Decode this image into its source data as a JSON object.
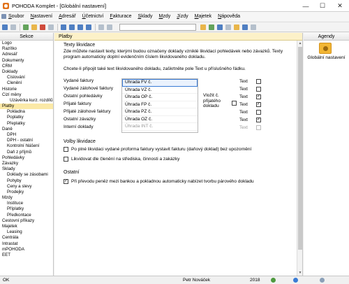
{
  "window": {
    "title": "POHODA Komplet - [Globální nastavení]"
  },
  "menu": [
    "Soubor",
    "Nastavení",
    "Adresář",
    "Účetnictví",
    "Fakturace",
    "Sklady",
    "Mzdy",
    "Jízdy",
    "Majetek",
    "Nápověda"
  ],
  "sidebar": {
    "title": "Sekce",
    "items": [
      {
        "label": "Logo",
        "level": 0
      },
      {
        "label": "Razítko",
        "level": 0
      },
      {
        "label": "Adresář",
        "level": 0
      },
      {
        "label": "Dokumenty",
        "level": 0
      },
      {
        "label": "CRM",
        "level": 0
      },
      {
        "label": "Doklady",
        "level": 0
      },
      {
        "label": "Číslování",
        "level": 1
      },
      {
        "label": "Členění",
        "level": 1
      },
      {
        "label": "Historie",
        "level": 0
      },
      {
        "label": "Cizí měny",
        "level": 0
      },
      {
        "label": "Uzávěrka kurz. rozdílů",
        "level": 2
      },
      {
        "label": "Platby",
        "level": 0,
        "active": true
      },
      {
        "label": "Pokladna",
        "level": 1
      },
      {
        "label": "Poplatky",
        "level": 1
      },
      {
        "label": "Přeplatky",
        "level": 1
      },
      {
        "label": "Daně",
        "level": 0
      },
      {
        "label": "DPH",
        "level": 1
      },
      {
        "label": "DPH - ostatní",
        "level": 1
      },
      {
        "label": "Kontrolní hlášení",
        "level": 1
      },
      {
        "label": "Daň z příjmů",
        "level": 1
      },
      {
        "label": "Pohledávky",
        "level": 0
      },
      {
        "label": "Závazky",
        "level": 0
      },
      {
        "label": "Sklady",
        "level": 0
      },
      {
        "label": "Doklady se zásobami",
        "level": 1
      },
      {
        "label": "Pohyby",
        "level": 1
      },
      {
        "label": "Ceny a slevy",
        "level": 1
      },
      {
        "label": "Prodejky",
        "level": 1
      },
      {
        "label": "Mzdy",
        "level": 0
      },
      {
        "label": "Instituce",
        "level": 1
      },
      {
        "label": "Příplatky",
        "level": 1
      },
      {
        "label": "Předkontace",
        "level": 1
      },
      {
        "label": "Cestovní příkazy",
        "level": 0
      },
      {
        "label": "Majetek",
        "level": 0
      },
      {
        "label": "Leasing",
        "level": 1
      },
      {
        "label": "Centrála",
        "level": 0
      },
      {
        "label": "Intrastat",
        "level": 0
      },
      {
        "label": "mPOHODA",
        "level": 0
      },
      {
        "label": "EET",
        "level": 0
      }
    ]
  },
  "main": {
    "header": "Platby",
    "texty": {
      "title": "Texty likvidace",
      "para1": "Zde můžete nastavit texty, kterými budou označeny doklady vzniklé likvidací pohledávek nebo závazků. Texty program automaticky doplní evidenčním číslem likvidovaného dokladu.",
      "para2": "Chcete-li připojit také text likvidovaného dokladu, zaškrtněte pole Text u příslušného řádku."
    },
    "rows": [
      {
        "label": "Vydané faktury",
        "prefix": "Úhrada FV č.",
        "text": "Text",
        "checked": false,
        "selected": true,
        "disabled": false
      },
      {
        "label": "Vydané zálohové faktury",
        "prefix": "Úhrada VZ č.",
        "text": "Text",
        "checked": false,
        "selected": false,
        "disabled": false
      },
      {
        "label": "Ostatní pohledávky",
        "prefix": "Úhrada OP č.",
        "text": "Text",
        "checked": true,
        "selected": false,
        "disabled": false
      },
      {
        "label": "Přijaté faktury",
        "prefix": "Úhrada FP č.",
        "text": "Text",
        "checked": true,
        "selected": false,
        "disabled": false
      },
      {
        "label": "Přijaté zálohové faktury",
        "prefix": "Úhrada PZ č.",
        "text": "Text",
        "checked": false,
        "selected": false,
        "disabled": false
      },
      {
        "label": "Ostatní závazky",
        "prefix": "Úhrada OZ č.",
        "text": "Text",
        "checked": true,
        "selected": false,
        "disabled": false
      },
      {
        "label": "Interní doklady",
        "prefix": "Úhrada INT č.",
        "text": "Text",
        "checked": false,
        "selected": false,
        "disabled": true
      }
    ],
    "vlozit_label": "Vložit č. přijatého dokladu",
    "vlozit_checked": false,
    "volby": {
      "title": "Volby likvidace",
      "option1": "Po plné likvidaci vydané proforma faktury vystavit fakturu (daňový doklad) bez upozornění",
      "option1_checked": false,
      "option2": "Likvidovat dle členění na střediska, činnosti a zakázky",
      "option2_checked": false
    },
    "ostatni": {
      "title": "Ostatní",
      "option": "Při převodu peněz mezi bankou a pokladnou automaticky nabízet tvorbu párového dokladu",
      "option_checked": true
    }
  },
  "agenda": {
    "title": "Agendy",
    "item": "Globální nastavení"
  },
  "status": {
    "ok": "OK",
    "user": "Petr Nováček",
    "year": "2018"
  },
  "colors": {
    "active_item": "#fbe9a7",
    "header_bg": "#fcf1c8",
    "accent": "#3a7bd5"
  }
}
